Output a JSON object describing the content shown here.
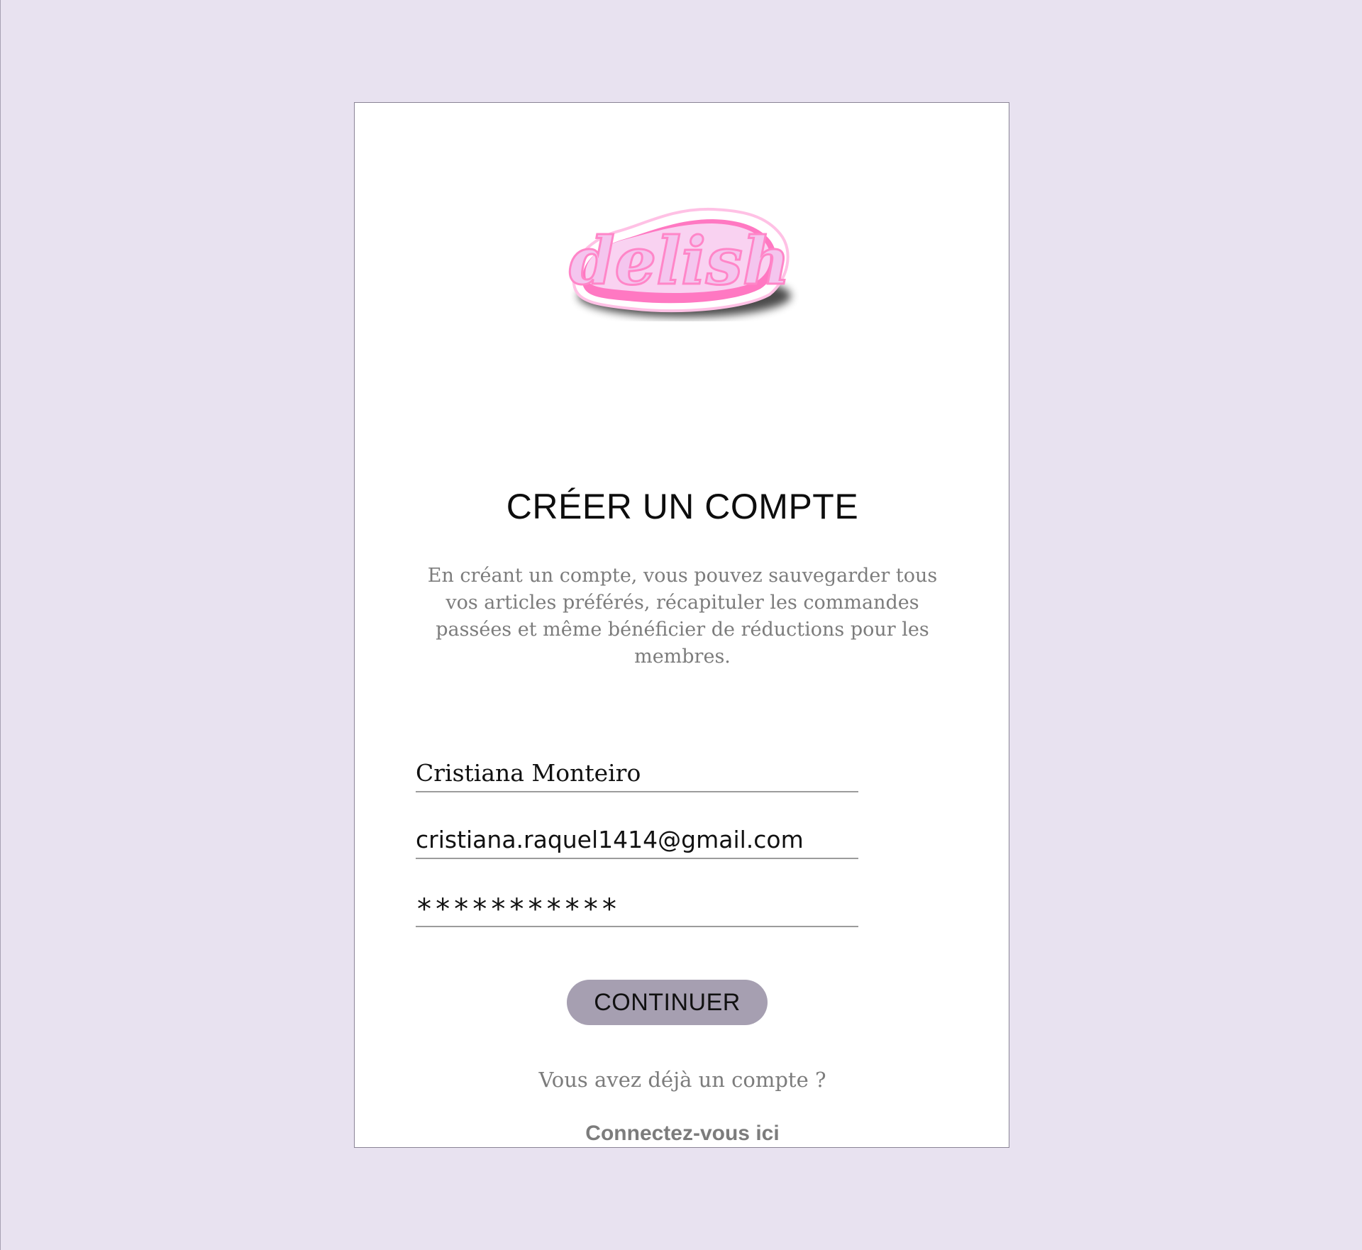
{
  "logo": {
    "text": "delish",
    "colors": {
      "fill": "#f8c9ec",
      "outline": "#ff6fb8",
      "shadow": "#000000"
    }
  },
  "signup": {
    "title": "CRÉER UN COMPTE",
    "description": "En créant un compte, vous pouvez sauvegarder tous vos articles préférés, récapituler les commandes passées et même bénéficier de réductions pour les membres.",
    "fields": {
      "name": "Cristiana Monteiro",
      "email": "cristiana.raquel1414@gmail.com",
      "password": "***********"
    },
    "continue_label": "CONTINUER",
    "already_text": "Vous avez déjà un compte ?",
    "login_link": "Connectez-vous ici"
  },
  "colors": {
    "background": "#e8e2f0",
    "button": "#a69fb1",
    "muted_text": "#7c7c7c"
  }
}
